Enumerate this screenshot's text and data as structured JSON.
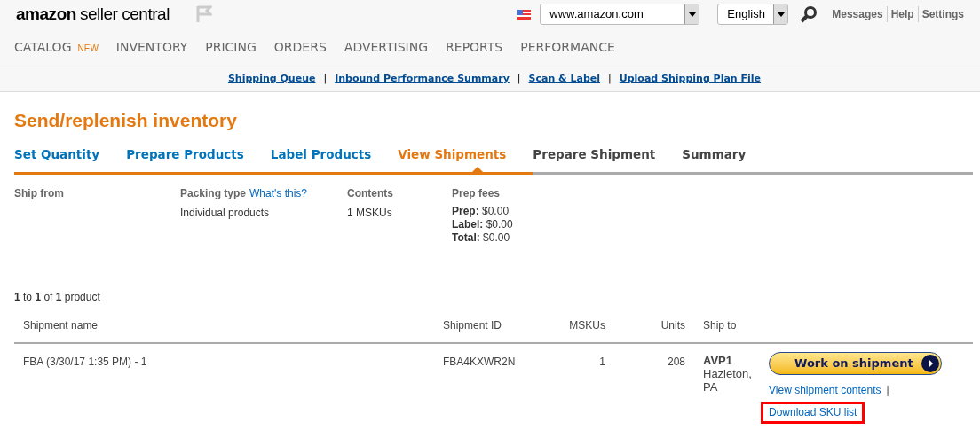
{
  "header": {
    "logo_bold": "amazon",
    "logo_rest": "seller central",
    "marketplace": "www.amazon.com",
    "language": "English",
    "links": [
      "Messages",
      "Help",
      "Settings"
    ]
  },
  "nav": [
    {
      "label": "CATALOG",
      "badge": "NEW"
    },
    {
      "label": "INVENTORY"
    },
    {
      "label": "PRICING"
    },
    {
      "label": "ORDERS"
    },
    {
      "label": "ADVERTISING"
    },
    {
      "label": "REPORTS"
    },
    {
      "label": "PERFORMANCE"
    }
  ],
  "subnav": [
    "Shipping Queue",
    "Inbound Performance Summary",
    "Scan & Label",
    "Upload Shipping Plan File"
  ],
  "subnav_separator": "|",
  "title": "Send/replenish inventory",
  "steps": [
    {
      "label": "Set Quantity",
      "completed": true,
      "selected": false
    },
    {
      "label": "Prepare Products",
      "completed": true,
      "selected": false
    },
    {
      "label": "Label Products",
      "completed": true,
      "selected": false
    },
    {
      "label": "View Shipments",
      "completed": true,
      "selected": true
    },
    {
      "label": "Prepare Shipment",
      "completed": false,
      "selected": false
    },
    {
      "label": "Summary",
      "completed": false,
      "selected": false
    }
  ],
  "summary": {
    "ship_from": "Ship from",
    "packing_label": "Packing type",
    "packing_help": "What's this?",
    "packing_value": "Individual products",
    "contents_label": "Contents",
    "contents_value": "1 MSKUs",
    "prep_label": "Prep fees",
    "prep_lines": [
      "**Prep:** $0.00",
      "**Label:** $0.00",
      "**Total:** $0.00"
    ]
  },
  "count": "**1** to **1** of **1** product",
  "table": {
    "columns": [
      "Shipment name",
      "Shipment ID",
      "MSKUs",
      "Units",
      "Ship to"
    ],
    "rows": [
      {
        "name": "FBA (3/30/17 1:35 PM) - 1",
        "id": "FBA4KXWR2N",
        "mskus": "1",
        "units": "208",
        "ship_code": "AVP1",
        "ship_city": "Hazleton,",
        "ship_state": "PA",
        "action": "Work on shipment",
        "link_separator": "|",
        "links": [
          {
            "label": "View shipment contents",
            "highlighted": false
          },
          {
            "label": "Download SKU list",
            "highlighted": true
          }
        ]
      }
    ]
  }
}
